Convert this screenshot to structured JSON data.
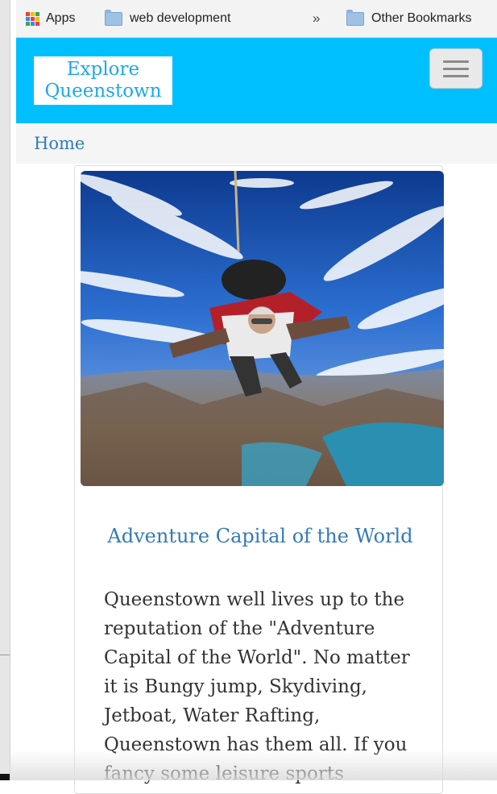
{
  "bookmarks": {
    "apps_label": "Apps",
    "folder_label": "web development",
    "overflow_label": "»",
    "other_label": "Other Bookmarks"
  },
  "navbar": {
    "brand_line1": "Explore",
    "brand_line2": "Queenstown",
    "toggle_icon": "hamburger-menu-icon"
  },
  "breadcrumb": {
    "home_label": "Home"
  },
  "card": {
    "image_icon": "skydiving-photo",
    "title": "Adventure Capital of the World",
    "text": "Queenstown well lives up to the reputation of the \"Adventure Capital of the World\". No matter it is Bungy jump, Skydiving, Jetboat, Water Rafting, Queenstown has them all. If you fancy some leisure sports"
  },
  "colors": {
    "navbar": "#00bfff",
    "brand_text": "#1aa9ea",
    "link": "#337ab7"
  }
}
